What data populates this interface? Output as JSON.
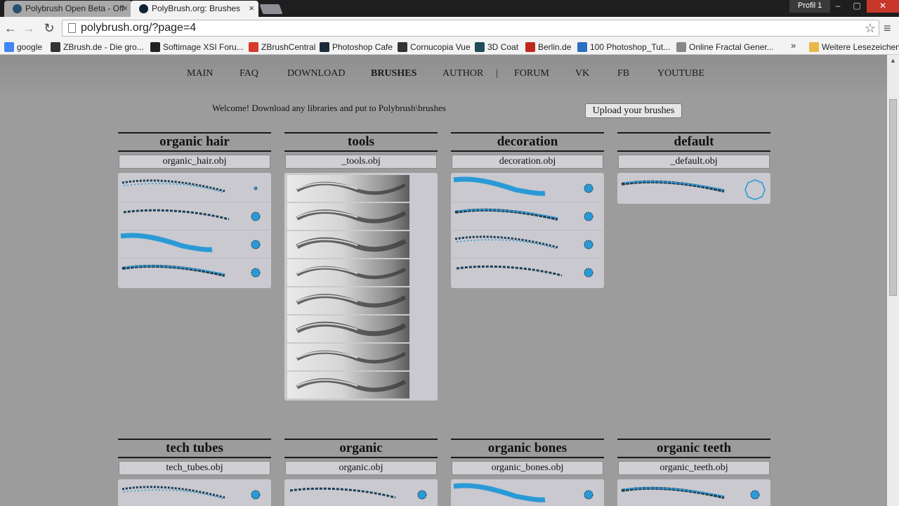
{
  "browser": {
    "tabs": [
      {
        "title": "Polybrush Open Beta - Off",
        "state": "inactive"
      },
      {
        "title": "PolyBrush.org: Brushes",
        "state": "active"
      }
    ],
    "tab_close_glyph": "×",
    "profile_label": "Profil 1",
    "window_buttons": {
      "minimize": "–",
      "maximize": "▢",
      "close": "✕"
    },
    "nav": {
      "back": "←",
      "forward": "→",
      "reload": "↻"
    },
    "url": "polybrush.org/?page=4",
    "bookmark_star": "☆",
    "menu_icon": "≡",
    "bookmarks": [
      {
        "label": "google",
        "icon": "google-icon",
        "color": "#4285f4"
      },
      {
        "label": "ZBrush.de - Die gro...",
        "icon": "zbrush-de-icon",
        "color": "#333333"
      },
      {
        "label": "Softimage XSI Foru...",
        "icon": "softimage-icon",
        "color": "#222222"
      },
      {
        "label": "ZBrushCentral",
        "icon": "zbrushcentral-icon",
        "color": "#d63a2a"
      },
      {
        "label": "Photoshop Cafe",
        "icon": "photoshop-cafe-icon",
        "color": "#1c2b3a"
      },
      {
        "label": "Cornucopia Vue",
        "icon": "cornucopia-icon",
        "color": "#333333"
      },
      {
        "label": "3D Coat",
        "icon": "3dcoat-icon",
        "color": "#1f4d5a"
      },
      {
        "label": "Berlin.de",
        "icon": "berlin-icon",
        "color": "#c0281c"
      },
      {
        "label": "100 Photoshop_Tut...",
        "icon": "photoshop-tut-icon",
        "color": "#2a6fc0"
      },
      {
        "label": "Online Fractal Gener...",
        "icon": "page-icon",
        "color": "#888888"
      }
    ],
    "bookmarks_more": "»",
    "other_bookmarks": "Weitere Lesezeichen"
  },
  "site": {
    "nav": [
      {
        "label": "MAIN"
      },
      {
        "label": "FAQ"
      },
      {
        "label": "DOWNLOAD"
      },
      {
        "label": "BRUSHES",
        "current": true
      },
      {
        "label": "AUTHOR"
      },
      {
        "label": "FORUM"
      },
      {
        "label": "VK"
      },
      {
        "label": "FB"
      },
      {
        "label": "YOUTUBE"
      }
    ],
    "nav_separator": "|",
    "welcome": "Welcome! Download any libraries and put to Polybrush\\brushes",
    "upload_button": "Upload your brushes",
    "libraries": [
      {
        "title": "organic hair",
        "file": "organic_hair.obj",
        "kind": "blue",
        "rows": 4
      },
      {
        "title": "tools",
        "file": "_tools.obj",
        "kind": "gray",
        "rows": 8
      },
      {
        "title": "decoration",
        "file": "decoration.obj",
        "kind": "blue",
        "rows": 4
      },
      {
        "title": "default",
        "file": "_default.obj",
        "kind": "blue",
        "rows": 1
      },
      {
        "title": "tech tubes",
        "file": "tech_tubes.obj",
        "kind": "blue",
        "rows": 1
      },
      {
        "title": "organic",
        "file": "organic.obj",
        "kind": "blue",
        "rows": 1
      },
      {
        "title": "organic bones",
        "file": "organic_bones.obj",
        "kind": "blue",
        "rows": 1
      },
      {
        "title": "organic teeth",
        "file": "organic_teeth.obj",
        "kind": "blue",
        "rows": 1
      }
    ],
    "colors": {
      "brush_blue": "#2a9ad6",
      "brush_dark": "#1a3d55",
      "panel": "#c9c9cf"
    }
  }
}
